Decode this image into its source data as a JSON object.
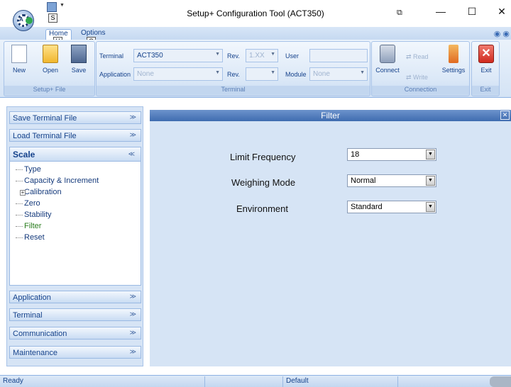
{
  "window": {
    "title": "Setup+ Configuration Tool (ACT350)",
    "minimize": "—",
    "maximize": "☐",
    "close": "✕"
  },
  "quick_access": {
    "keytip": "S"
  },
  "tabs": [
    {
      "label": "Home",
      "keytip": "H"
    },
    {
      "label": "Options",
      "keytip": "O"
    }
  ],
  "ribbon": {
    "file_group": {
      "label": "Setup+ File",
      "new": "New",
      "open": "Open",
      "save": "Save"
    },
    "terminal_group": {
      "label": "Terminal",
      "terminal_label": "Terminal",
      "terminal_value": "ACT350",
      "rev_label": "Rev.",
      "rev_value": "1.XX",
      "user_label": "User",
      "user_value": "",
      "application_label": "Application",
      "application_value": "None",
      "rev2_label": "Rev.",
      "rev2_value": "",
      "module_label": "Module",
      "module_value": "None"
    },
    "connection_group": {
      "label": "Connection",
      "connect": "Connect",
      "read": "Read",
      "write": "Write",
      "settings": "Settings"
    },
    "exit_group": {
      "label": "Exit",
      "exit": "Exit"
    }
  },
  "sidebar": {
    "top_items": [
      {
        "label": "Save Terminal File"
      },
      {
        "label": "Load Terminal File"
      }
    ],
    "scale": {
      "label": "Scale",
      "items": [
        "Type",
        "Capacity & Increment",
        "Calibration",
        "Zero",
        "Stability",
        "Filter",
        "Reset"
      ]
    },
    "bottom_items": [
      {
        "label": "Application"
      },
      {
        "label": "Terminal"
      },
      {
        "label": "Communication"
      },
      {
        "label": "Maintenance"
      }
    ]
  },
  "filter_panel": {
    "title": "Filter",
    "fields": [
      {
        "label": "Limit Frequency",
        "value": "18"
      },
      {
        "label": "Weighing Mode",
        "value": "Normal"
      },
      {
        "label": "Environment",
        "value": "Standard"
      }
    ]
  },
  "statusbar": {
    "status": "Ready",
    "profile": "Default"
  }
}
